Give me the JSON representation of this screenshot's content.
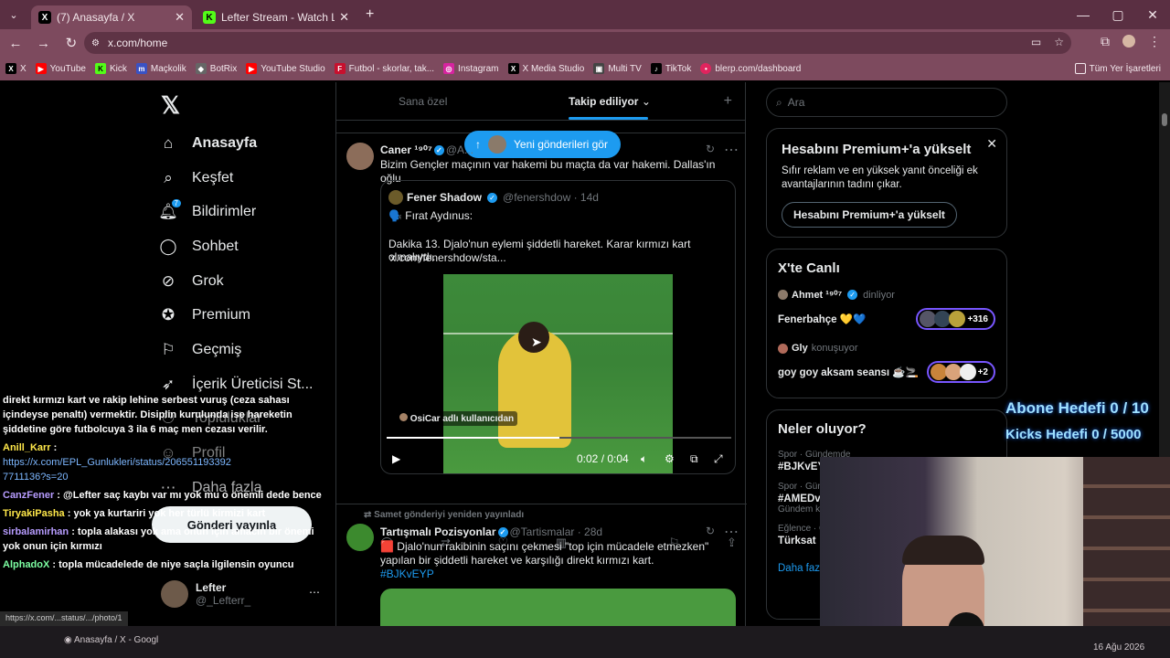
{
  "browser": {
    "tabs": [
      {
        "title": "(7) Anasayfa / X",
        "icon": "x-logo-icon"
      },
      {
        "title": "Lefter Stream - Watch Live on K",
        "icon": "kick-logo-icon"
      }
    ],
    "url": "x.com/home",
    "bookmarks": [
      "X",
      "YouTube",
      "Kick",
      "Maçkolik",
      "BotRix",
      "YouTube Studio",
      "Futbol - skorlar, tak...",
      "Instagram",
      "X Media Studio",
      "Multi TV",
      "TikTok",
      "blerp.com/dashboard"
    ],
    "all_bookmarks": "Tüm Yer İşaretleri"
  },
  "sidebar": {
    "items": [
      {
        "label": "Anasayfa",
        "icon": "home-icon"
      },
      {
        "label": "Keşfet",
        "icon": "search-icon"
      },
      {
        "label": "Bildirimler",
        "icon": "bell-icon",
        "badge": "7"
      },
      {
        "label": "Sohbet",
        "icon": "chat-icon"
      },
      {
        "label": "Grok",
        "icon": "grok-icon"
      },
      {
        "label": "Premium",
        "icon": "premium-icon"
      },
      {
        "label": "Geçmiş",
        "icon": "bookmark-icon"
      },
      {
        "label": "İçerik Üreticisi St...",
        "icon": "rocket-icon"
      },
      {
        "label": "Topluluklar",
        "icon": "communities-icon"
      },
      {
        "label": "Profil",
        "icon": "profile-icon"
      },
      {
        "label": "Daha fazla",
        "icon": "more-icon"
      }
    ],
    "post_button": "Gönderi yayınla",
    "profile_name": "Lefter",
    "profile_handle": "@_Lefterr_"
  },
  "chat": {
    "lines": [
      {
        "user": "",
        "text": "direkt kırmızı kart ve rakip lehine serbest vuruş (ceza sahası içindeyse penaltı) vermektir. Disiplin kurulunda ise hareketin şiddetine göre futbolcuya 3 ila 6 maç men cezası verilir.",
        "color": "#ffffff"
      },
      {
        "user": "Anill_Karr",
        "text": " :",
        "color": "#ffe84a"
      },
      {
        "user": "",
        "text": "https://x.com/EPL_Gunlukleri/status/2065511933927711136?s=20",
        "color": "#7db7ff",
        "link": true
      },
      {
        "user": "CanzFener",
        "text": " : @Lefter saç kaybı var mı yok mu o önemli dede bence",
        "color": "#b79cff"
      },
      {
        "user": "TiryakiPasha",
        "text": " : yok ya kurtariri yok her türlü kirmizi kart",
        "color": "#ffe84a"
      },
      {
        "user": "sirbalamirhan",
        "text": " : topla alakası yok ama onun için amacın bir önemi yok onun için kırmızı",
        "color": "#b79cff"
      },
      {
        "user": "AlphadoX",
        "text": " : topla mücadelede de niye saçla ilgilensin oyuncu",
        "color": "#7dffa3"
      }
    ]
  },
  "feed": {
    "tabs": [
      "Sana özel",
      "Takip ediliyor"
    ],
    "new_posts": "Yeni gönderileri gör",
    "post1": {
      "name": "Caner ¹⁹⁰⁷",
      "handle": "@A...",
      "text": "Bizim Gençler maçının var hakemi bu maçta da var hakemi. Dallas'ın oğlu",
      "quote_name": "Fener Shadow",
      "quote_handle": "@fenershdow · 14d",
      "quote_line1": "🗣️ Fırat Aydınus:",
      "quote_line2": "Dakika 13. Djalo'nun eylemi şiddetli hareket. Karar kırmızı kart olmalıydı.",
      "quote_link": "x.com/fenershdow/sta...",
      "video_credit": "OsiCar adlı kullanıcıdan",
      "video_time": "0:02 / 0:04",
      "video_progress": 0.5
    },
    "repost_label": "Samet gönderiyi yeniden yayınladı",
    "post2": {
      "name": "Tartışmalı Pozisyonlar",
      "handle": "@Tartismalar · 28d",
      "text": "🟥 Djalo'nun rakibinin saçını çekmesi \"top için mücadele etmezken\" yapılan bir şiddetli hareket ve karşılığı direkt kırmızı kart.",
      "hashtag": "#BJKvEYP"
    }
  },
  "right": {
    "search_placeholder": "Ara",
    "premium": {
      "title": "Hesabını Premium+'a yükselt",
      "text": "Sıfır reklam ve en yüksek yanıt önceliği ek avantajlarının tadını çıkar.",
      "button": "Hesabını Premium+'a yükselt"
    },
    "live": {
      "title": "X'te Canlı",
      "items": [
        {
          "host": "Ahmet ¹⁹⁰⁷",
          "status": "dinliyor",
          "title": "Fenerbahçe 💛💙",
          "count": "+316"
        },
        {
          "host": "Gly",
          "status": "konuşuyor",
          "title": "goy goy aksam seansı ☕🚬",
          "count": "+2"
        }
      ]
    },
    "trends": {
      "title": "Neler oluyor?",
      "items": [
        {
          "meta": "Spor · Gündemde",
          "name": "#BJKvEYP"
        },
        {
          "meta": "Spor · Gündemde",
          "name": "#AMEDv...",
          "sub": "Gündem k..."
        },
        {
          "meta": "Eğlence · Gündemde",
          "name": "Türksat"
        }
      ],
      "more": "Daha fazla"
    }
  },
  "overlay": {
    "sub_goal": "Abone Hedefi 0 / 10",
    "kicks_goal": "Kicks Hedefi 0 / 5000"
  },
  "status_url": "https://x.com/...status/.../photo/1",
  "taskbar": {
    "window": "Anasayfa / X - Googl",
    "date": "16 Ağu 2026"
  }
}
